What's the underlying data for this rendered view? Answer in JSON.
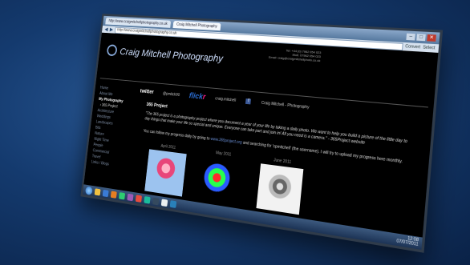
{
  "browser": {
    "tabs": [
      {
        "label": "http://www.craigmitchellphotography.co.uk"
      },
      {
        "label": "Craig Mitchell Photography"
      }
    ],
    "address": "http://www.craigmitchellphotography.co.uk",
    "tools": [
      "Convert",
      "Select"
    ],
    "window_buttons": [
      "–",
      "□",
      "✕"
    ]
  },
  "site": {
    "contact": [
      "Tel: +44 (0) 7962 054 023",
      "Mob: 07962 054 023",
      "Email: craig@craigmitchellphoto.co.uk"
    ],
    "logo_text": "Craig Mitchell Photography",
    "sidebar": [
      {
        "label": "Home",
        "style": "dim"
      },
      {
        "label": "About Me",
        "style": "dim"
      },
      {
        "label": "My Photography",
        "style": "bright"
      },
      {
        "label": "› 365 Project",
        "style": "sub"
      },
      {
        "label": "Architecture",
        "style": "dim"
      },
      {
        "label": "Weddings",
        "style": "dim"
      },
      {
        "label": "Landscapes",
        "style": "dim"
      },
      {
        "label": "Bits",
        "style": "dim"
      },
      {
        "label": "Nature",
        "style": "dim"
      },
      {
        "label": "Night Time",
        "style": "dim"
      },
      {
        "label": "People",
        "style": "dim"
      },
      {
        "label": "Commercial",
        "style": "dim"
      },
      {
        "label": "Travel",
        "style": "dim"
      },
      {
        "label": "Links / Blogs",
        "style": "dim"
      }
    ],
    "social": {
      "twitter_label": "twitter",
      "twitter_handle": "@pmitch90",
      "flickr_a": "flick",
      "flickr_b": "r",
      "flickr_user": "craig.mitchell",
      "facebook_label": "Craig Mitchell - Photography"
    },
    "heading": "365 Project",
    "paragraph": "\"The 365 project is a photography project where you document a year of your life by taking a daily photo. We want to help you build a picture of the little day to day things that make your life so special and unique. Everyone can take part and join in! All you need is a camera.\" - 365Project website",
    "follow_text_a": "You can follow my progress daily by going to",
    "follow_link": "www.365project.org",
    "follow_text_b": "and searching for 'cpmitchell' (the username). I will try to upload my progress here monthly.",
    "photos": [
      {
        "month": "April 2011"
      },
      {
        "month": "May 2011"
      },
      {
        "month": "June 2011"
      }
    ]
  },
  "taskbar": {
    "clock_time": "12:08",
    "clock_date": "07/07/2011"
  }
}
